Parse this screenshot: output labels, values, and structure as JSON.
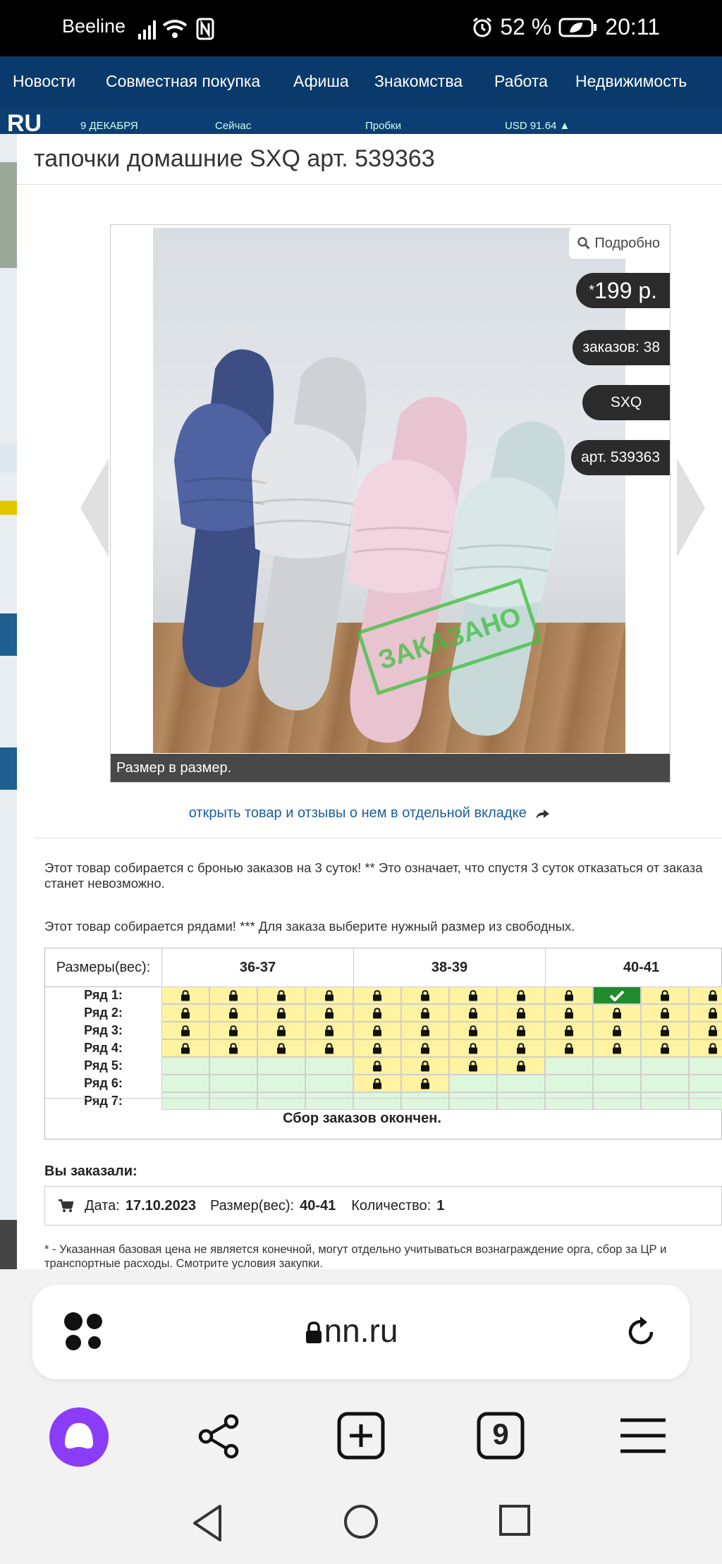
{
  "status_bar": {
    "carrier": "Beeline",
    "battery": "52 %",
    "time": "20:11"
  },
  "site_nav": {
    "items": [
      "Новости",
      "Совместная покупка",
      "Афиша",
      "Знакомства",
      "Работа",
      "Недвижимость"
    ]
  },
  "site_info": {
    "logo": "RU",
    "date": "9 ДЕКАБРЯ",
    "weather": "Сейчас",
    "traffic": "Пробки",
    "currency": "USD 91.64 ▲"
  },
  "product": {
    "title": "тапочки домашние SXQ арт. 539363",
    "detail_label": "Подробно",
    "price_mark": "*",
    "price": "199 р.",
    "orders": "заказов: 38",
    "brand": "SXQ",
    "article": "арт. 539363",
    "caption": "Размер в размер.",
    "stamp": "ЗАКАЗАНО",
    "open_link": "открыть товар и отзывы о нем в отдельной вкладке"
  },
  "notices": {
    "reservation": "Этот товар собирается с бронью заказов на 3 суток! ** Это означает, что спустя 3 суток отказаться от заказа станет невозможно.",
    "rows": "Этот товар собирается рядами! *** Для заказа выберите нужный размер из свободных."
  },
  "size_grid": {
    "header_label": "Размеры(вес):",
    "sizes": [
      "36-37",
      "38-39",
      "40-41"
    ],
    "rows": [
      {
        "label": "Ряд 1:",
        "cells": [
          "busy",
          "busy",
          "busy",
          "busy",
          "busy",
          "busy",
          "busy",
          "busy",
          "busy",
          "mine",
          "busy",
          "busy"
        ]
      },
      {
        "label": "Ряд 2:",
        "cells": [
          "busy",
          "busy",
          "busy",
          "busy",
          "busy",
          "busy",
          "busy",
          "busy",
          "busy",
          "busy",
          "busy",
          "busy"
        ]
      },
      {
        "label": "Ряд 3:",
        "cells": [
          "busy",
          "busy",
          "busy",
          "busy",
          "busy",
          "busy",
          "busy",
          "busy",
          "busy",
          "busy",
          "busy",
          "busy"
        ]
      },
      {
        "label": "Ряд 4:",
        "cells": [
          "busy",
          "busy",
          "busy",
          "busy",
          "busy",
          "busy",
          "busy",
          "busy",
          "busy",
          "busy",
          "busy",
          "busy"
        ]
      },
      {
        "label": "Ряд 5:",
        "cells": [
          "free",
          "free",
          "free",
          "free",
          "busy",
          "busy",
          "busy",
          "busy",
          "free",
          "free",
          "free",
          "free"
        ]
      },
      {
        "label": "Ряд 6:",
        "cells": [
          "free",
          "free",
          "free",
          "free",
          "busy",
          "busy",
          "free",
          "free",
          "free",
          "free",
          "free",
          "free"
        ]
      },
      {
        "label": "Ряд 7:",
        "cells": [
          "free",
          "free",
          "free",
          "free",
          "free",
          "free",
          "free",
          "free",
          "free",
          "free",
          "free",
          "free"
        ]
      }
    ],
    "footer": "Сбор заказов окончен."
  },
  "order": {
    "title": "Вы заказали:",
    "date_label": "Дата:",
    "date": "17.10.2023",
    "size_label": "Размер(вес):",
    "size": "40-41",
    "qty_label": "Количество:",
    "qty": "1"
  },
  "footnote": "* - Указанная базовая цена не является конечной, могут отдельно учитываться вознаграждение орга, сбор за ЦР и транспортные расходы. Смотрите условия закупки.",
  "browser": {
    "url": "nn.ru",
    "tabs_count": "9"
  },
  "colors": {
    "lock_cell": "#fdf3a0",
    "free_cell": "#ddf7dc",
    "ordered_cell": "#1f8b2c",
    "alice": "#8a3cf7",
    "nav_bg": "#0a3a6b"
  }
}
